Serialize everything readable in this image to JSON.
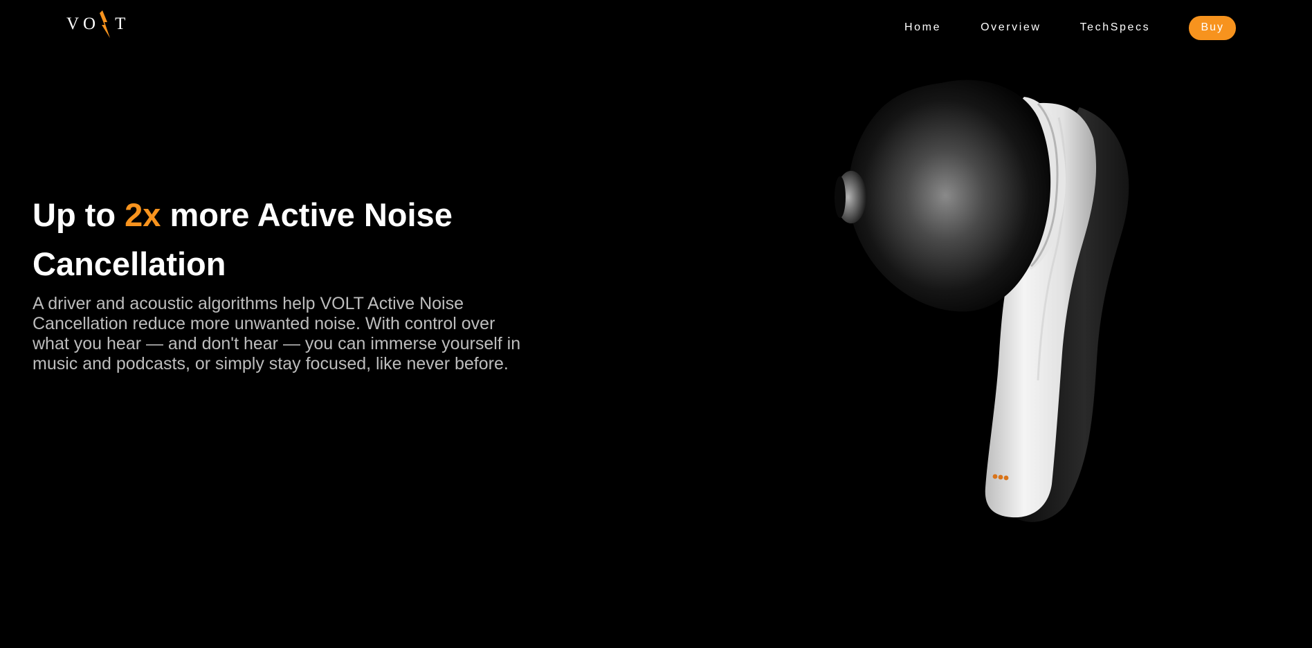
{
  "brand": {
    "logo_left": "VO",
    "logo_right": "T",
    "logo_icon": "lightning-bolt-icon"
  },
  "nav": {
    "items": [
      {
        "label": "Home"
      },
      {
        "label": "Overview"
      },
      {
        "label": "TechSpecs"
      }
    ],
    "buy_label": "Buy"
  },
  "hero": {
    "heading_pre": "Up to ",
    "heading_accent": "2x",
    "heading_post": " more Active Noise Cancellation",
    "body": "A driver and acoustic algorithms help VOLT Active Noise Cancellation reduce more unwanted noise. With control over what you hear — and don't hear — you can immerse yourself in music and podcasts, or simply stay focused, like never before."
  },
  "product": {
    "image": "wireless-earbud-image"
  },
  "colors": {
    "background": "#000000",
    "accent": "#f7931e",
    "text": "#ffffff",
    "body_text": "#bdbdbd"
  }
}
